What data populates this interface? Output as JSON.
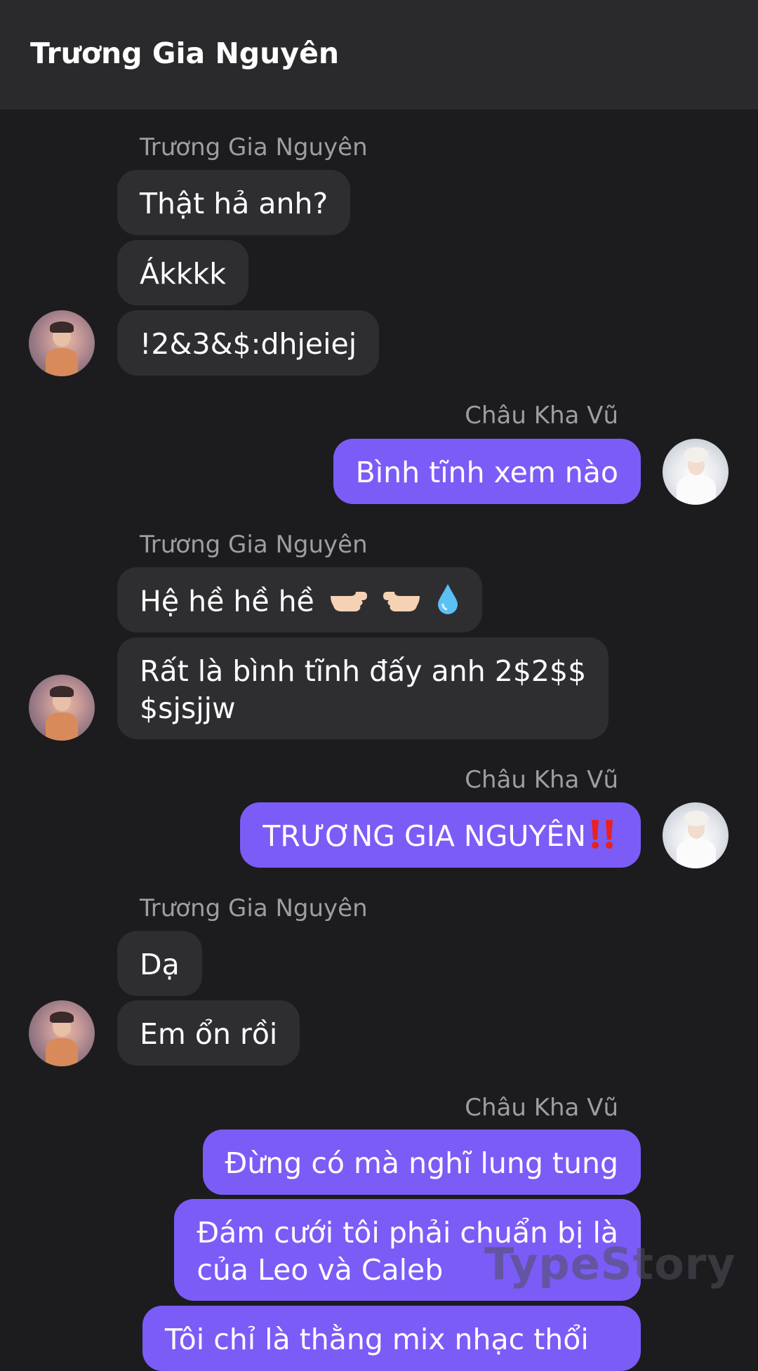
{
  "header": {
    "title": "Trương Gia Nguyên"
  },
  "colors": {
    "outgoing_bubble": "#7b5cf7",
    "incoming_bubble": "#2e2e31",
    "background": "#1c1c1e"
  },
  "messages": {
    "group1": {
      "sender": "Trương Gia Nguyên",
      "lines": [
        "Thật hả anh?",
        "Ákkkk",
        "!2&3&$:dhjeiej"
      ]
    },
    "group2": {
      "sender": "Châu Kha Vũ",
      "lines": [
        "Bình tĩnh xem nào"
      ]
    },
    "group3": {
      "sender": "Trương Gia Nguyên",
      "lines": [
        "Hệ hề hề hề",
        "Rất là bình tĩnh đấy anh 2$2$$",
        "$sjsjjw"
      ],
      "emoji": [
        "point-right-icon",
        "point-left-icon",
        "droplet-icon"
      ]
    },
    "group4": {
      "sender": "Châu Kha Vũ",
      "lines": [
        "TRƯƠNG GIA NGUYÊN"
      ],
      "emoji": [
        "double-exclamation-icon"
      ]
    },
    "group5": {
      "sender": "Trương Gia Nguyên",
      "lines": [
        "Dạ",
        "Em ổn rồi"
      ]
    },
    "group6": {
      "sender": "Châu Kha Vũ",
      "lines": [
        "Đừng có mà nghĩ lung tung",
        "Đám cưới tôi phải chuẩn bị là",
        "của Leo và Caleb",
        "Tôi chỉ là thằng mix nhạc thổi"
      ]
    }
  },
  "watermark": "TypeStory"
}
